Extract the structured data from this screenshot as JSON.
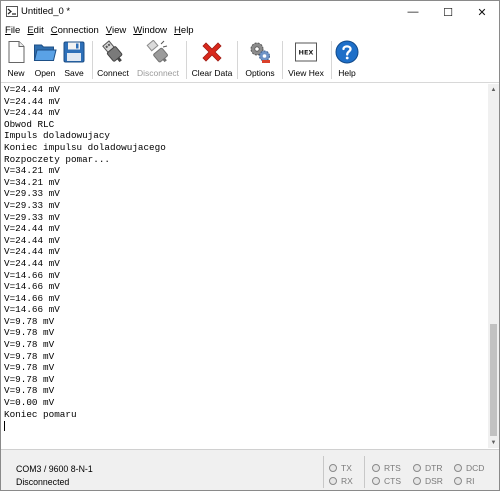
{
  "window": {
    "title": "Untitled_0 *",
    "minimize_glyph": "—",
    "maximize_glyph": "☐",
    "close_glyph": "✕"
  },
  "menu": {
    "items": [
      {
        "key": "F",
        "rest": "ile"
      },
      {
        "key": "E",
        "rest": "dit"
      },
      {
        "key": "C",
        "rest": "onnection"
      },
      {
        "key": "V",
        "rest": "iew"
      },
      {
        "key": "W",
        "rest": "indow"
      },
      {
        "key": "H",
        "rest": "elp"
      }
    ]
  },
  "toolbar": {
    "new": "New",
    "open": "Open",
    "save": "Save",
    "connect": "Connect",
    "disconnect": "Disconnect",
    "clear": "Clear Data",
    "options": "Options",
    "viewhex": "View Hex",
    "hex_badge": "HEX",
    "help": "Help"
  },
  "terminal": {
    "lines": [
      "V=24.44 mV",
      "V=24.44 mV",
      "V=24.44 mV",
      "Obwod RLC",
      "Impuls doladowujacy",
      "Koniec impulsu doladowujacego",
      "Rozpoczety pomar...",
      "V=34.21 mV",
      "V=34.21 mV",
      "V=29.33 mV",
      "V=29.33 mV",
      "V=29.33 mV",
      "V=24.44 mV",
      "V=24.44 mV",
      "V=24.44 mV",
      "V=24.44 mV",
      "V=14.66 mV",
      "V=14.66 mV",
      "V=14.66 mV",
      "V=14.66 mV",
      "V=9.78 mV",
      "V=9.78 mV",
      "V=9.78 mV",
      "V=9.78 mV",
      "V=9.78 mV",
      "V=9.78 mV",
      "V=9.78 mV",
      "V=0.00 mV",
      "Koniec pomaru"
    ]
  },
  "status": {
    "port": "COM3 / 9600 8-N-1",
    "connection": "Disconnected",
    "leds": {
      "tx": "TX",
      "rx": "RX",
      "rts": "RTS",
      "cts": "CTS",
      "dtr": "DTR",
      "dsr": "DSR",
      "dcd": "DCD",
      "ri": "RI"
    }
  },
  "colors": {
    "help_blue": "#1e6fc8",
    "clear_red": "#d9281c",
    "folder_blue": "#3a86d0"
  }
}
